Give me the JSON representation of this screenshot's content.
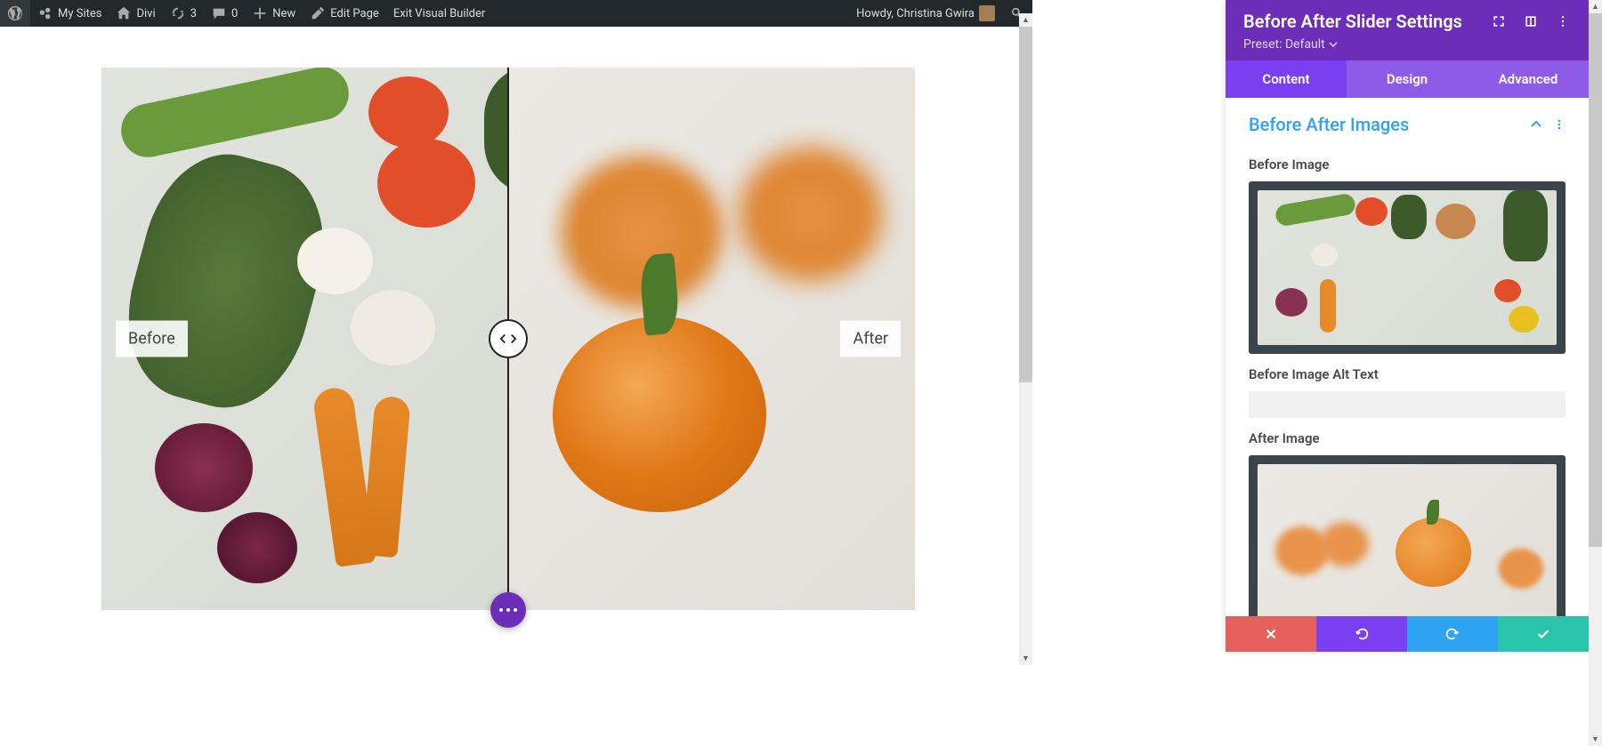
{
  "adminbar": {
    "mysites": "My Sites",
    "sitename": "Divi",
    "updates": "3",
    "comments": "0",
    "new": "New",
    "editpage": "Edit Page",
    "exitvb": "Exit Visual Builder",
    "howdy": "Howdy, Christina Gwira"
  },
  "slider": {
    "before_label": "Before",
    "after_label": "After"
  },
  "panel": {
    "title": "Before After Slider Settings",
    "preset_label": "Preset: Default",
    "tabs": {
      "content": "Content",
      "design": "Design",
      "advanced": "Advanced"
    },
    "section_title": "Before After Images",
    "before_image_label": "Before Image",
    "before_alt_label": "Before Image Alt Text",
    "before_alt_value": "",
    "after_image_label": "After Image"
  }
}
